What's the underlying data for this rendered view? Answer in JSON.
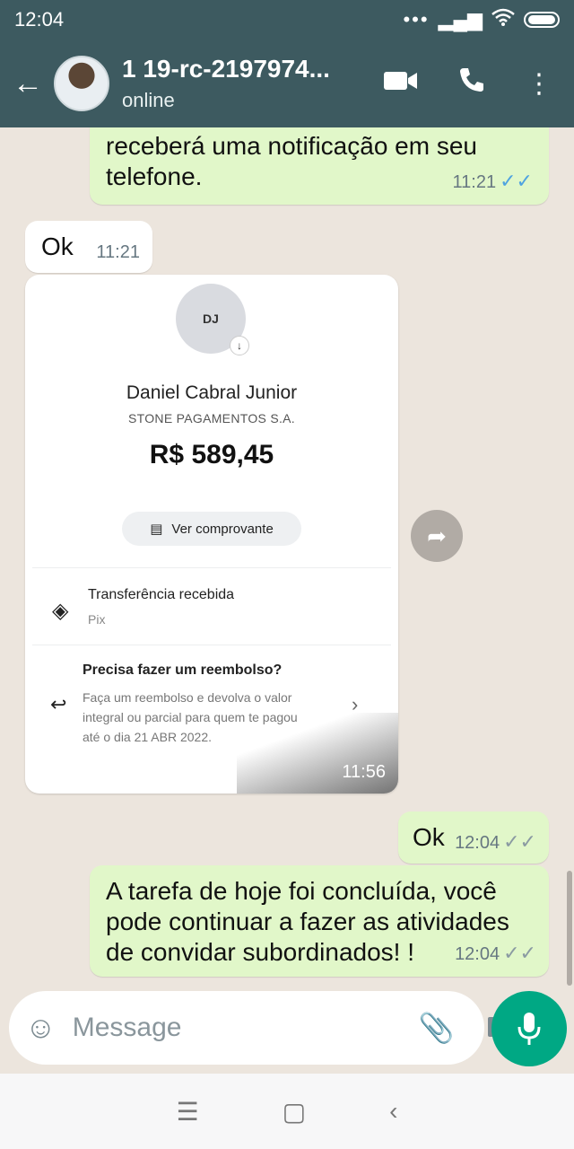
{
  "status_bar": {
    "time": "12:04",
    "icons": [
      "signal-dots-icon",
      "cell-signal-icon",
      "wifi-icon",
      "battery-icon"
    ]
  },
  "header": {
    "contact_name": "1 19-rc-2197974...",
    "contact_status": "online",
    "icons": [
      "back-arrow-icon",
      "video-call-icon",
      "voice-call-icon",
      "more-options-icon"
    ]
  },
  "messages": [
    {
      "type": "outgoing",
      "text": "recebrá uma notificação em seu telefone.",
      "line1": "receberá uma notificação em seu",
      "line2": "telefone.",
      "time": "11:21",
      "read": true
    },
    {
      "type": "incoming",
      "text": "Ok",
      "time": "11:21"
    },
    {
      "type": "incoming_image",
      "time": "11:56",
      "card": {
        "initials": "DJ",
        "payer_name": "Daniel Cabral Junior",
        "institution": "STONE PAGAMENTOS S.A.",
        "amount": "R$ 589,45",
        "receipt_button": "Ver comprovante",
        "transaction_title": "Transferência recebida",
        "transaction_method": "Pix",
        "refund_title": "Precisa fazer um reembolso?",
        "refund_text_1": "Faça um reembolso e devolva o valor",
        "refund_text_2": "integral ou parcial para quem te pagou",
        "refund_text_3": "até o dia 21 ABR 2022."
      }
    },
    {
      "type": "outgoing",
      "text": "Ok",
      "time": "12:04",
      "read": false
    },
    {
      "type": "outgoing",
      "line1": "A tarefa de hoje foi concluída, você",
      "line2": "pode continuar a fazer as atividades",
      "line3": "de convidar subordinados! !",
      "time": "12:04",
      "read": false
    }
  ],
  "composer": {
    "placeholder": "Message"
  },
  "colors": {
    "header": "#3d5a60",
    "outgoing_bubble": "#e1f7c9",
    "incoming_bubble": "#ffffff",
    "mic_button": "#00a884",
    "chat_background": "#ece5dd"
  }
}
